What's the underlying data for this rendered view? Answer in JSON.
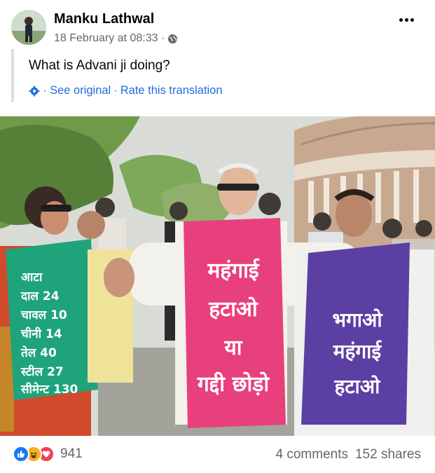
{
  "post": {
    "author": "Manku Lathwal",
    "timestamp": "18 February at 08:33 ·",
    "audience_icon": "globe-icon",
    "text": "What is Advani ji doing?",
    "translation": {
      "icon": "gear-icon",
      "see_original": "· See original",
      "separator": "·",
      "rate": "Rate this translation"
    }
  },
  "photo": {
    "signs": {
      "left_price_list": [
        "आटा",
        "दाल 24",
        "चावल 10",
        "चीनी 14",
        "तेल 40",
        "स्टील 27",
        "सीमेन्ट 130"
      ],
      "center_sign": [
        "महंगाई",
        "हटाओ",
        "या",
        "गद्दी छोड़ो"
      ],
      "right_sign": [
        "भगाओ",
        "महंगाई",
        "हटाओ"
      ]
    }
  },
  "footer": {
    "reactions": [
      "like-icon",
      "haha-icon",
      "love-icon"
    ],
    "reaction_count": "941",
    "comments": "4 comments",
    "shares": "152 shares"
  },
  "colors": {
    "link": "#216fdb",
    "muted": "#65676b",
    "center_sign": "#e8407c",
    "right_sign": "#5b3fa3",
    "left_sign": "#1fa37a"
  }
}
